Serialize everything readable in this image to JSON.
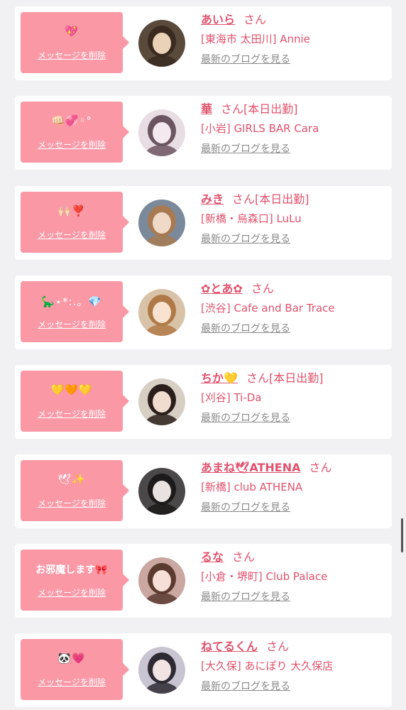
{
  "delete_label": "メッセージを削除",
  "blog_label": "最新のブログを見る",
  "honorific": "さん",
  "colors": {
    "bubble": "#fb98a6",
    "name": "#e0526d",
    "blog": "#8a8a8a"
  },
  "cards": [
    {
      "message": "💖",
      "name": "あいら",
      "badge": "",
      "shop": "[東海市 太田川] Annie",
      "avatar": {
        "bg": "#5a4a3c",
        "fg": "#e9d2b8",
        "hair": "#3a2a20"
      }
    },
    {
      "message": "👊🏻💞◦°",
      "name": "華",
      "badge": "[本日出勤]",
      "shop": "[小岩] GIRLS BAR Cara",
      "avatar": {
        "bg": "#e8dde3",
        "fg": "#f3e9ee",
        "hair": "#6b5560"
      }
    },
    {
      "message": "🙌🏻❣️",
      "name": "みき",
      "badge": "[本日出勤]",
      "shop": "[新橋・烏森口] LuLu",
      "avatar": {
        "bg": "#7a8a9a",
        "fg": "#f1d9c8",
        "hair": "#a77a52"
      }
    },
    {
      "message": "🦕⋆*:.。💎",
      "name": "✿とあ✿",
      "badge": "",
      "shop": "[渋谷] Cafe and Bar Trace",
      "avatar": {
        "bg": "#d9c3a8",
        "fg": "#f7e3d0",
        "hair": "#b07a48"
      }
    },
    {
      "message": "💛🧡💛",
      "name": "ちか💛",
      "badge": "[本日出勤]",
      "shop": "[刈谷] Ti-Da",
      "avatar": {
        "bg": "#d7cfc4",
        "fg": "#f0ddd0",
        "hair": "#2b1f1b"
      }
    },
    {
      "message": "🕊✨",
      "name": "あまね🕊ATHENA",
      "badge": "",
      "shop": "[新橋] club ATHENA",
      "avatar": {
        "bg": "#4a4848",
        "fg": "#e8e2e0",
        "hair": "#1c1a1a"
      }
    },
    {
      "message": "お邪魔します🎀",
      "name": "るな",
      "badge": "",
      "shop": "[小倉・堺町] Club Palace",
      "avatar": {
        "bg": "#caa7a0",
        "fg": "#f6dfd7",
        "hair": "#5b3a30"
      }
    },
    {
      "message": "🐼💗",
      "name": "ねてるくん",
      "badge": "",
      "shop": "[大久保] あにぽり 大久保店",
      "avatar": {
        "bg": "#c9c4d2",
        "fg": "#f2e4e2",
        "hair": "#2e2a33"
      }
    }
  ]
}
